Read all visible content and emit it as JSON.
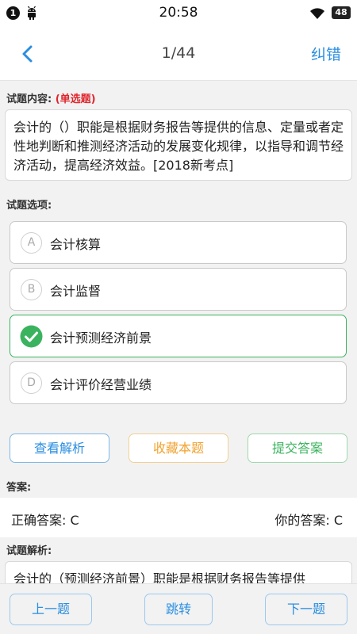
{
  "status_bar": {
    "notification_count": "1",
    "time": "20:58",
    "battery": "48"
  },
  "header": {
    "progress": "1/44",
    "report_error": "纠错"
  },
  "question": {
    "section_label": "试题内容:",
    "type_tag": "(单选题)",
    "text": "会计的（）职能是根据财务报告等提供的信息、定量或者定性地判断和推测经济活动的发展变化规律，以指导和调节经济活动，提高经济效益。[2018新考点]"
  },
  "options": {
    "section_label": "试题选项:",
    "items": [
      {
        "letter": "A",
        "text": "会计核算",
        "selected": false
      },
      {
        "letter": "B",
        "text": "会计监督",
        "selected": false
      },
      {
        "letter": "C",
        "text": "会计预测经济前景",
        "selected": true
      },
      {
        "letter": "D",
        "text": "会计评价经营业绩",
        "selected": false
      }
    ]
  },
  "actions": {
    "view_analysis": "查看解析",
    "favorite": "收藏本题",
    "submit": "提交答案"
  },
  "answer": {
    "section_label": "答案:",
    "correct": "正确答案: C",
    "yours": "你的答案: C"
  },
  "analysis": {
    "section_label": "试题解析:",
    "text": "会计的（预测经济前景）职能是根据财务报告等提供"
  },
  "footer": {
    "prev": "上一题",
    "jump": "跳转",
    "next": "下一题"
  },
  "colors": {
    "accent_blue": "#2a8ee0",
    "correct_green": "#3bb35e",
    "favorite_orange": "#f0a330",
    "tag_red": "#e0262d"
  }
}
